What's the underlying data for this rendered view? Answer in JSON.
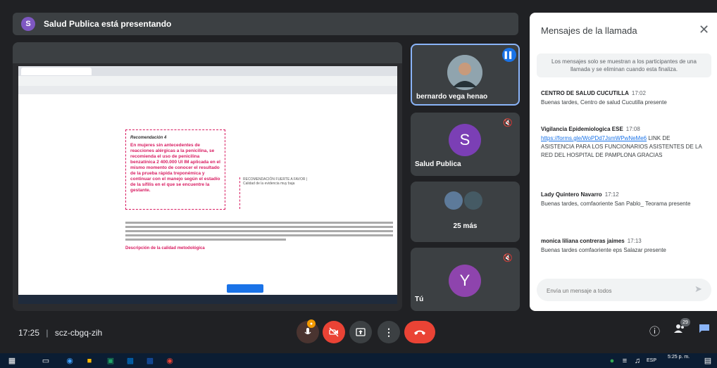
{
  "presenting_banner": {
    "avatar_letter": "S",
    "text": "Salud Publica está presentando"
  },
  "participants": [
    {
      "name": "bernardo vega henao"
    },
    {
      "name": "Salud Publica",
      "avatar_letter": "S"
    },
    {
      "name": "25 más"
    },
    {
      "name": "Tú",
      "avatar_letter": "Y"
    }
  ],
  "shared_doc": {
    "reco_title": "Recomendación 4",
    "reco_body": "En mujeres sin antecedentes de reacciones alérgicas a la penicilina, se recomienda el uso de penicilina benzatínica 2 400.000 UI IM aplicada en el mismo momento de conocer el resultado de la prueba rápida treponémica y continuar con el manejo según el estadío de la sífilis en el que se encuentre la gestante.",
    "reco_tag": "RECOMENDACIÓN FUERTE A FAVOR | Calidad de la evidencia muy baja",
    "section_heading": "Descripción de la calidad metodológica"
  },
  "chat": {
    "title": "Mensajes de la llamada",
    "info": "Los mensajes solo se muestran a los participantes de una llamada y se eliminan cuando esta finaliza.",
    "messages": [
      {
        "author": "CENTRO DE SALUD CUCUTILLA",
        "time": "17:02",
        "text": "Buenas tardes, Centro de salud Cucutilla presente"
      },
      {
        "author": "Vigilancia Epidemiologica ESE",
        "time": "17:08",
        "link": "https://forms.gle/WoPDd7JsmWPwNeMe6",
        "text": " LINK DE ASISTENCIA PARA LOS FUNCIONARIOS ASISTENTES DE LA RED DEL HOSPITAL DE PAMPLONA GRACIAS"
      },
      {
        "author": "Lady Quintero Navarro",
        "time": "17:12",
        "text": "Buenas tardes, comfaoriente San Pablo_ Teorama presente"
      },
      {
        "author": "monica liliana contreras jaimes",
        "time": "17:13",
        "text": "Buenas tardes comfaoriente eps Salazar presente"
      }
    ],
    "input_placeholder": "Envía un mensaje a todos"
  },
  "meeting": {
    "clock": "17:25",
    "separator": "|",
    "code": "scz-cbgq-zih",
    "people_count": "29"
  },
  "os": {
    "time": "5:25 p. m.",
    "date": "",
    "lang": "ESP"
  },
  "colors": {
    "accent": "#1a73e8",
    "danger": "#ea4335",
    "highlight": "#d81b60"
  }
}
